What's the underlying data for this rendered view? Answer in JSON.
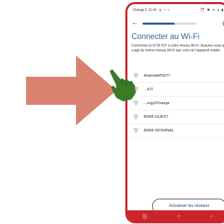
{
  "status_bar": {
    "carrier_time": "Orange F 11:41",
    "icons_left": [
      "whatsapp-icon",
      "photo-icon",
      "dot-icon"
    ],
    "icons_right": [
      "alarm-icon",
      "bluetooth-icon",
      "mute-icon",
      "wifi-icon",
      "signal-icon",
      "battery-icon"
    ]
  },
  "header": {
    "back_icon": "arrow-left-icon",
    "progress": 0.6,
    "help_icon": "help-circle-icon",
    "help_glyph": "?"
  },
  "page": {
    "title": "Connecter au Wi-Fi",
    "description": "Connectez la GTW IOT à votre réseau Wi-Fi. Assurez-vous qu'il s'agit du même réseau Wi-Fi que celui de l'appareil mobile."
  },
  "networks": [
    {
      "ssid": "AndroidAP3077"
    },
    {
      "ssid": "...IOT"
    },
    {
      "ssid": "...ergy2Change"
    },
    {
      "ssid": "BDRF-GUEST"
    },
    {
      "ssid": "BDRF-INTERNAL"
    }
  ],
  "refresh_button": "Actualiser les réseaux",
  "nav": {
    "recents": "|||",
    "home": "○",
    "back": "‹"
  },
  "colors": {
    "accent": "#2e5f96",
    "phone_case": "#c9252b",
    "arrow": "#d9826f",
    "hand": "#3c7a2a"
  }
}
